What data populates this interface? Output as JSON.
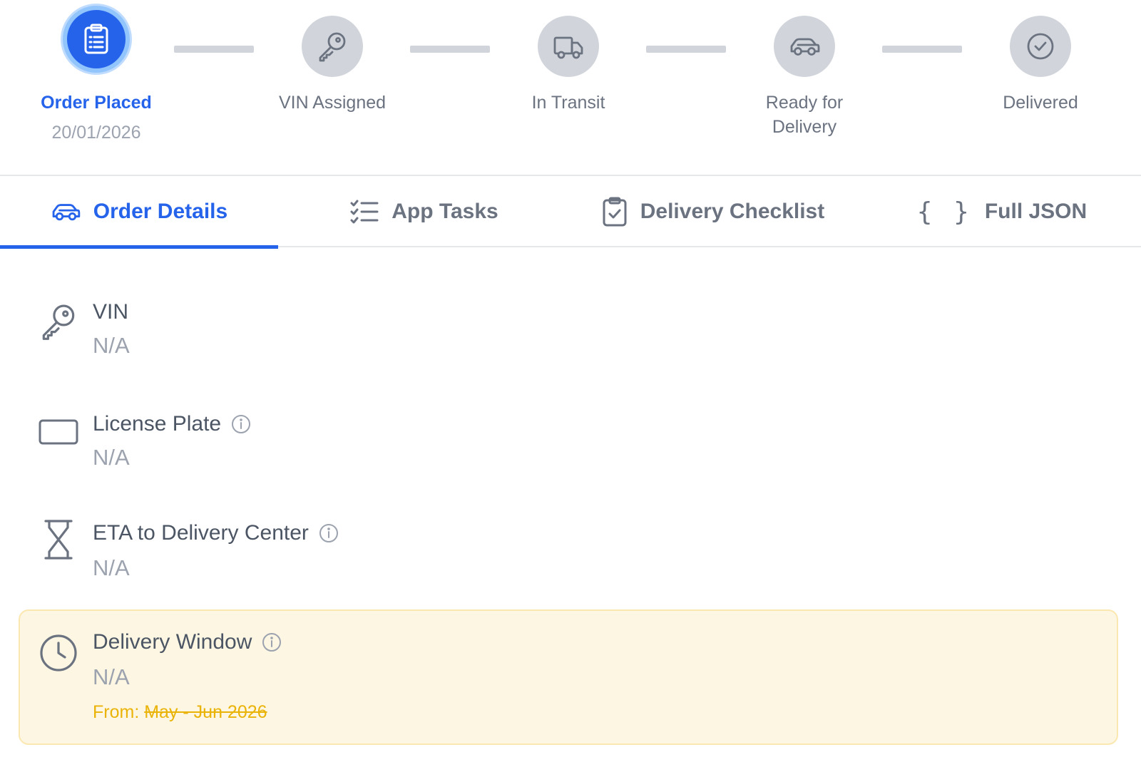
{
  "stepper": {
    "steps": [
      {
        "label": "Order Placed",
        "date": "20/01/2026",
        "state": "active",
        "icon": "clipboard-icon"
      },
      {
        "label": "VIN Assigned",
        "state": "pending",
        "icon": "key-icon"
      },
      {
        "label": "In Transit",
        "state": "pending",
        "icon": "truck-icon"
      },
      {
        "label": "Ready for Delivery",
        "state": "pending",
        "icon": "car-icon"
      },
      {
        "label": "Delivered",
        "state": "pending",
        "icon": "check-circle-icon"
      }
    ]
  },
  "tabs": [
    {
      "label": "Order Details",
      "icon": "car-icon",
      "active": true
    },
    {
      "label": "App Tasks",
      "icon": "checklist-icon",
      "active": false
    },
    {
      "label": "Delivery Checklist",
      "icon": "clipboard-check-icon",
      "active": false
    },
    {
      "label": "Full JSON",
      "icon": "braces-icon",
      "active": false
    }
  ],
  "details": {
    "vin": {
      "label": "VIN",
      "value": "N/A",
      "icon": "key-icon"
    },
    "license_plate": {
      "label": "License Plate",
      "value": "N/A",
      "icon": "license-plate-icon"
    },
    "eta": {
      "label": "ETA to Delivery Center",
      "value": "N/A",
      "icon": "hourglass-icon"
    },
    "delivery_window": {
      "label": "Delivery Window",
      "value": "N/A",
      "icon": "clock-icon",
      "from_label": "From:",
      "from_value": "May - Jun 2026"
    }
  },
  "colors": {
    "accent": "#2563eb",
    "accent_ring": "#93c5fd",
    "pending_circle": "#d1d5db",
    "muted_text": "#9ca3af",
    "highlight_bg": "#fdf6e3",
    "highlight_text": "#eab308"
  }
}
